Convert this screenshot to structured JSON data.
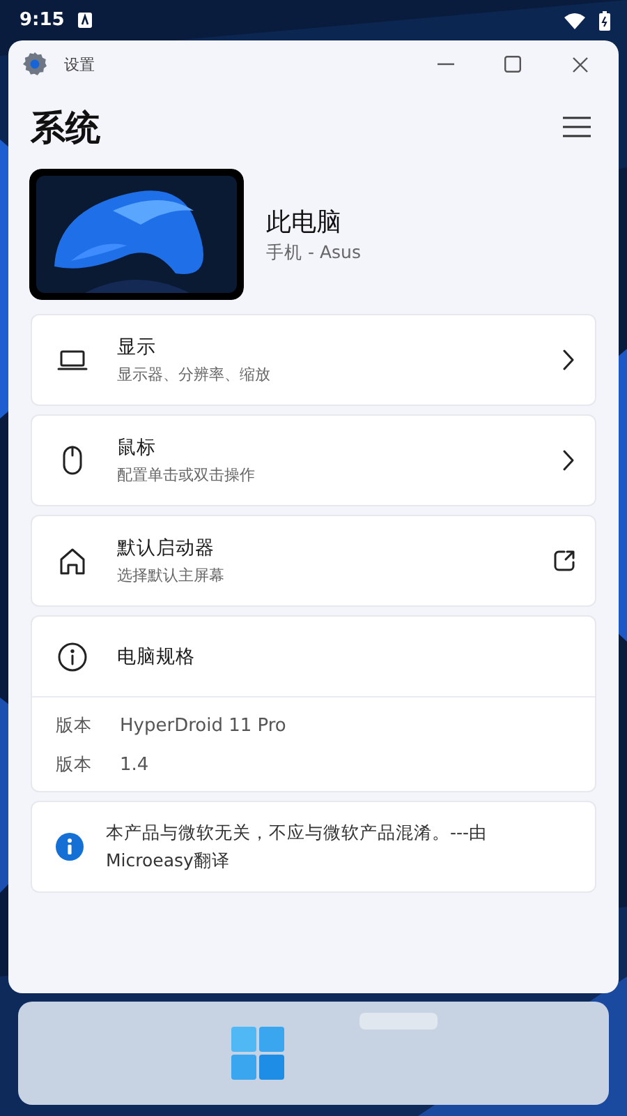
{
  "status_bar": {
    "time": "9:15"
  },
  "window": {
    "title": "设置"
  },
  "page": {
    "heading": "系统"
  },
  "device": {
    "name": "此电脑",
    "subtitle": "手机 - Asus"
  },
  "settings": [
    {
      "kind": "navigate",
      "title": "显示",
      "subtitle": "显示器、分辨率、缩放"
    },
    {
      "kind": "navigate",
      "title": "鼠标",
      "subtitle": "配置单击或双击操作"
    },
    {
      "kind": "external",
      "title": "默认启动器",
      "subtitle": "选择默认主屏幕"
    }
  ],
  "specs": {
    "title": "电脑规格",
    "rows": [
      {
        "label": "版本",
        "value": "HyperDroid 11 Pro"
      },
      {
        "label": "版本",
        "value": "1.4"
      }
    ]
  },
  "note": {
    "text": "本产品与微软无关，不应与微软产品混淆。---由Microeasy翻译"
  }
}
